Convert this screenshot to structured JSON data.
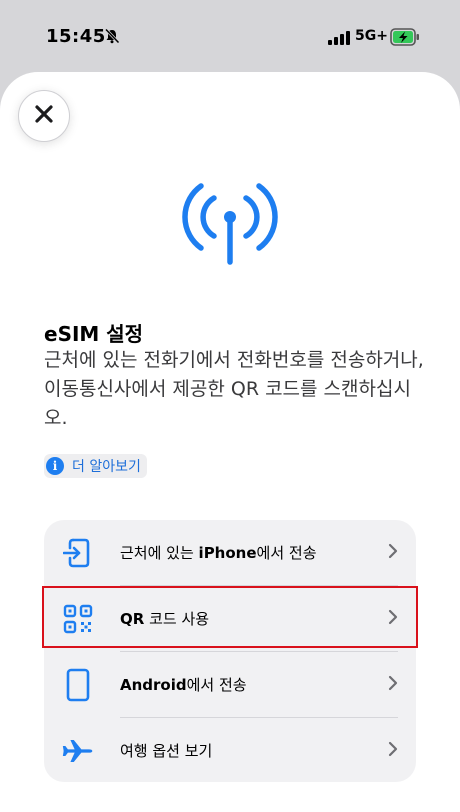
{
  "status_bar": {
    "time": "15:45",
    "network": "5G+"
  },
  "title": "eSIM 설정",
  "description": "근처에 있는 전화기에서 전화번호를 전송하거나, 이동통신사에서 제공한 QR 코드를 스캔하십시오.",
  "learn_more": {
    "label": "더 알아보기",
    "icon_glyph": "i"
  },
  "options": [
    {
      "icon": "phone-transfer-icon",
      "label_prefix": "근처에 있는 ",
      "label_bold": "iPhone",
      "label_suffix": "에서 전송"
    },
    {
      "icon": "qr-code-icon",
      "label_prefix": "",
      "label_bold": "QR",
      "label_suffix": " 코드 사용"
    },
    {
      "icon": "android-phone-icon",
      "label_prefix": "",
      "label_bold": "Android",
      "label_suffix": "에서 전송"
    },
    {
      "icon": "airplane-icon",
      "label_prefix": "여행 옵션 보기",
      "label_bold": "",
      "label_suffix": ""
    }
  ],
  "colors": {
    "accent": "#1e7ef0",
    "highlight": "#d9111b"
  }
}
